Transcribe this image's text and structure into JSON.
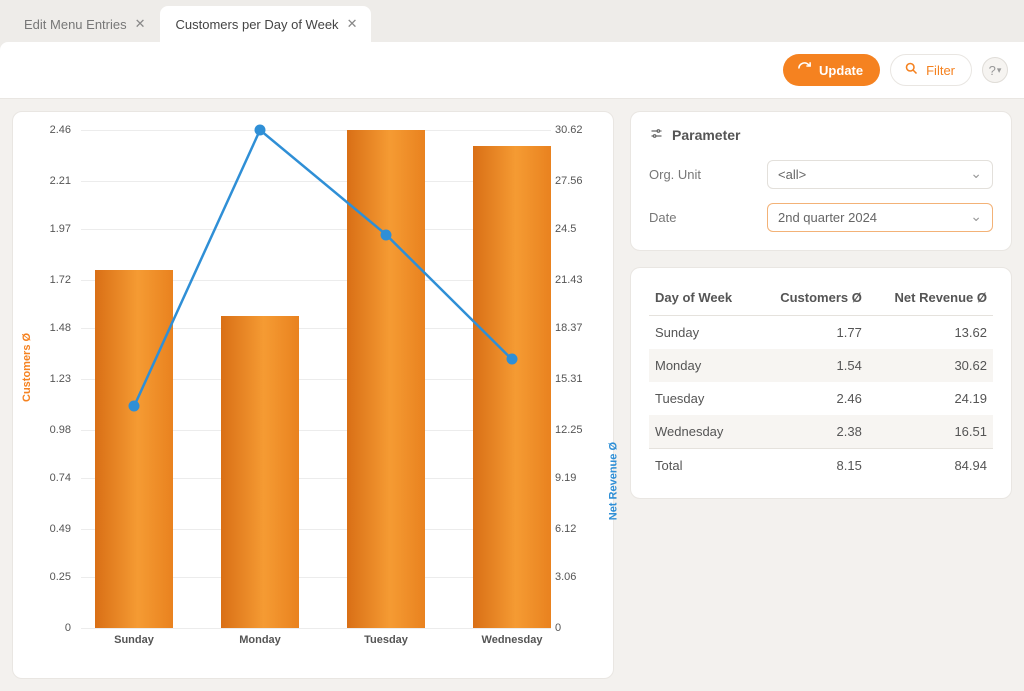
{
  "tabs": [
    {
      "label": "Edit Menu Entries",
      "active": false
    },
    {
      "label": "Customers per Day of Week",
      "active": true
    }
  ],
  "toolbar": {
    "update_label": "Update",
    "filter_label": "Filter"
  },
  "parameter_panel": {
    "title": "Parameter",
    "org_unit_label": "Org. Unit",
    "org_unit_value": "<all>",
    "date_label": "Date",
    "date_value": "2nd quarter 2024"
  },
  "table": {
    "headers": [
      "Day of Week",
      "Customers Ø",
      "Net Revenue Ø"
    ],
    "rows": [
      {
        "day": "Sunday",
        "customers": "1.77",
        "revenue": "13.62"
      },
      {
        "day": "Monday",
        "customers": "1.54",
        "revenue": "30.62"
      },
      {
        "day": "Tuesday",
        "customers": "2.46",
        "revenue": "24.19"
      },
      {
        "day": "Wednesday",
        "customers": "2.38",
        "revenue": "16.51"
      }
    ],
    "total": {
      "day": "Total",
      "customers": "8.15",
      "revenue": "84.94"
    }
  },
  "chart_data": {
    "type": "bar+line",
    "categories": [
      "Sunday",
      "Monday",
      "Tuesday",
      "Wednesday"
    ],
    "series": [
      {
        "name": "Customers Ø",
        "axis": "left",
        "type": "bar",
        "values": [
          1.77,
          1.54,
          2.46,
          2.38
        ]
      },
      {
        "name": "Net Revenue Ø",
        "axis": "right",
        "type": "line",
        "values": [
          13.62,
          30.62,
          24.19,
          16.51
        ]
      }
    ],
    "y_left": {
      "label": "Customers Ø",
      "ticks": [
        0,
        0.25,
        0.49,
        0.74,
        0.98,
        1.23,
        1.48,
        1.72,
        1.97,
        2.21,
        2.46
      ],
      "min": 0,
      "max": 2.46
    },
    "y_right": {
      "label": "Net Revenue Ø",
      "ticks": [
        0,
        3.06,
        6.12,
        9.19,
        12.25,
        15.31,
        18.37,
        21.43,
        24.5,
        27.56,
        30.62
      ],
      "min": 0,
      "max": 30.62
    }
  }
}
